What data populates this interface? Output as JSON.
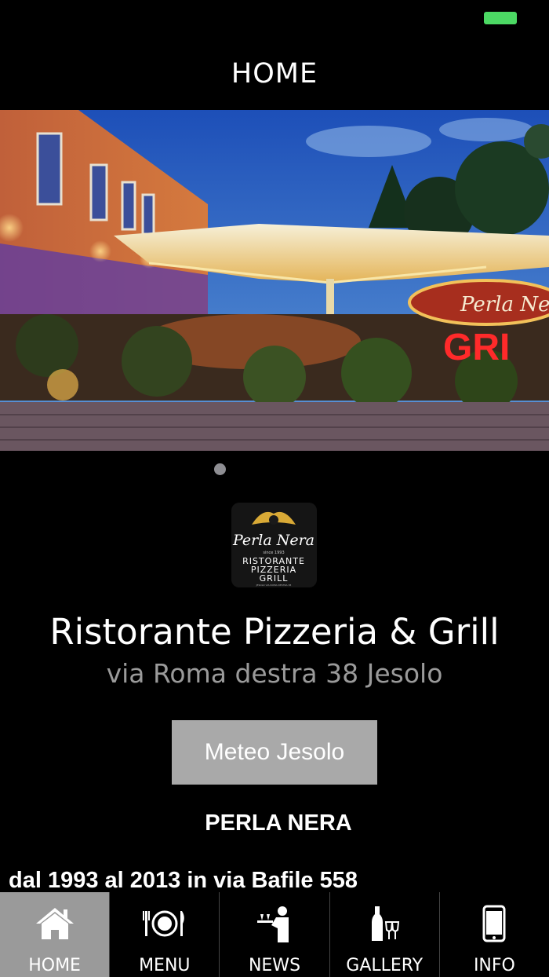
{
  "nav": {
    "title": "HOME"
  },
  "hero": {
    "sign_text": "Perla Ne",
    "sign_grill": "GRI"
  },
  "logo": {
    "name": "Perla Nera",
    "since": "since 1993",
    "line1": "RISTORANTE",
    "line2": "PIZZERIA",
    "line3": "GRILL",
    "address": "JESOLO VIA ROMA DESTRA 38"
  },
  "restaurant": {
    "title": "Ristorante Pizzeria & Grill",
    "address": "via Roma destra 38 Jesolo",
    "button_label": "Meteo Jesolo",
    "heading": "PERLA NERA",
    "history": "dal 1993 al 2013 in via Bafile 558"
  },
  "tabs": [
    {
      "label": "HOME",
      "icon": "home-icon",
      "active": true
    },
    {
      "label": "MENU",
      "icon": "plate-icon",
      "active": false
    },
    {
      "label": "NEWS",
      "icon": "waiter-icon",
      "active": false
    },
    {
      "label": "GALLERY",
      "icon": "wine-icon",
      "active": false
    },
    {
      "label": "INFO",
      "icon": "phone-icon",
      "active": false
    }
  ],
  "colors": {
    "battery": "#4cd964",
    "active_tab": "#9a9a9a",
    "button": "#a9a9a9"
  }
}
